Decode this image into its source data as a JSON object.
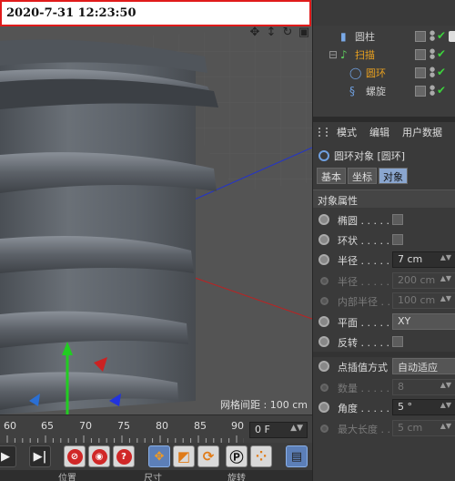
{
  "timestamp": "2020-7-31 12:23:50",
  "viewport": {
    "grid_spacing": "网格间距 : 100 cm",
    "nav_icons": [
      "move-view-icon",
      "zoom-view-icon",
      "rotate-view-icon",
      "maximize-view-icon"
    ]
  },
  "timeline": {
    "ticks": [
      "60",
      "65",
      "70",
      "75",
      "80",
      "85",
      "90"
    ],
    "frame_field": "0 F"
  },
  "toolbar": {
    "buttons": [
      "play-button",
      "goto-end-button",
      "keyframe-record-button",
      "autokey-button",
      "keyframe-select-button",
      "move-key-button",
      "scale-key-button",
      "rotate-key-button",
      "param-key-button",
      "pla-key-button",
      "timeline-button"
    ]
  },
  "statusbar": {
    "position": "位置",
    "size": "尺寸",
    "rotate": "旋转"
  },
  "object_manager": {
    "items": [
      {
        "name": "圆柱",
        "icon": "cylinder-icon",
        "color": "#c8c8c8"
      },
      {
        "name": "扫描",
        "icon": "sweep-icon",
        "color": "#e8a020"
      },
      {
        "name": "圆环",
        "icon": "circle-spline-icon",
        "color": "#e8a020"
      },
      {
        "name": "螺旋",
        "icon": "helix-icon",
        "color": "#c8c8c8"
      }
    ]
  },
  "attributes": {
    "menu": [
      "模式",
      "编辑",
      "用户数据"
    ],
    "object_title": "圆环对象 [圆环]",
    "tabs": [
      "基本",
      "坐标",
      "对象"
    ],
    "active_tab": "对象",
    "section": "对象属性",
    "props": {
      "ellipse": {
        "label": "椭圆 . . . . . ."
      },
      "ring": {
        "label": "环状 . . . . . ."
      },
      "radius": {
        "label": "半径 . . . . . .",
        "value": "7 cm"
      },
      "radius2": {
        "label": "半径 . . . . . .",
        "value": "200 cm"
      },
      "inner_radius": {
        "label": "内部半径 . . .",
        "value": "100 cm"
      },
      "plane": {
        "label": "平面 . . . . . .",
        "value": "XY"
      },
      "reverse": {
        "label": "反转 . . . . . ."
      },
      "interpolation": {
        "label": "点插值方式",
        "value": "自动适应"
      },
      "count": {
        "label": "数量 . . . . . .",
        "value": "8"
      },
      "angle": {
        "label": "角度 . . . . . .",
        "value": "5 °"
      },
      "max_length": {
        "label": "最大长度 . . .",
        "value": "5 cm"
      }
    }
  },
  "colors": {
    "accent_blue": "#8aa6cf",
    "highlight_orange": "#e8a020",
    "timestamp_border": "#e01b1b"
  }
}
